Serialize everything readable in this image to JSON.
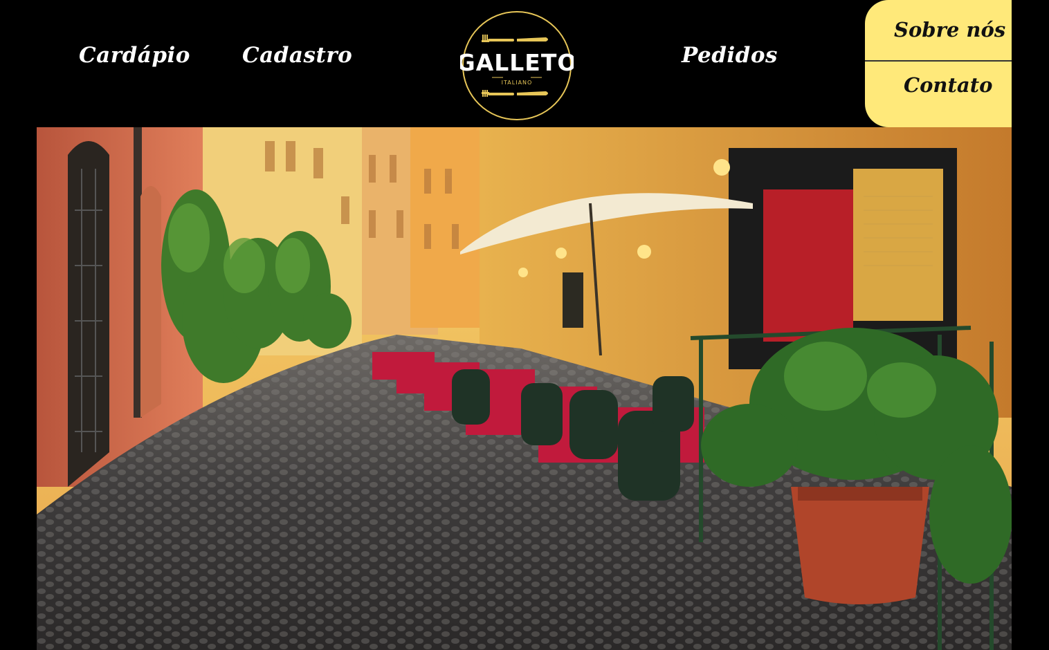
{
  "nav": {
    "left_links": [
      {
        "label": "Cardápio"
      },
      {
        "label": "Cadastro"
      }
    ],
    "right_links": [
      {
        "label": "Pedidos"
      }
    ]
  },
  "logo": {
    "name": "GALLETO",
    "subtitle": "ITALIANO",
    "icon": "fork-and-knife-icon"
  },
  "side_menu": {
    "items": [
      {
        "label": "Sobre nós"
      },
      {
        "label": "Contato"
      }
    ],
    "background": "#ffe97a"
  },
  "hero": {
    "image": "italian-street-cafe-photo"
  },
  "colors": {
    "header_bg": "#000000",
    "nav_text": "#ffffff",
    "accent_yellow": "#ffe97a",
    "logo_gold": "#e7c658"
  }
}
